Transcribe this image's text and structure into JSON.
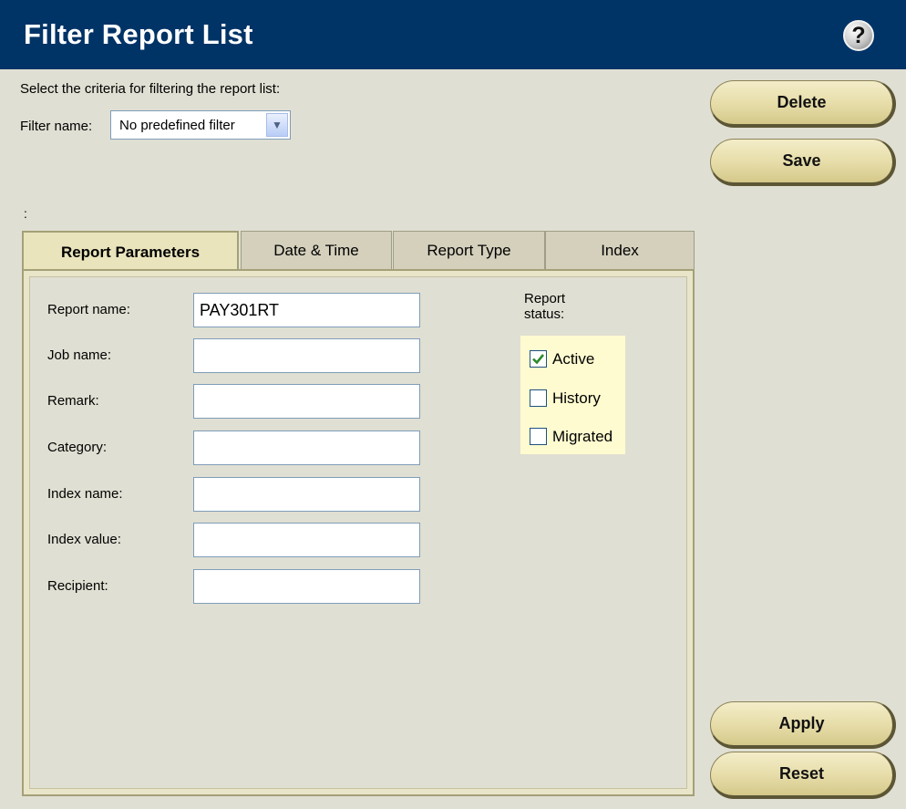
{
  "header": {
    "title": "Filter Report List",
    "help_icon": "help-icon",
    "help_glyph": "?"
  },
  "intro": {
    "criteria_text": "Select the criteria for filtering the report list:",
    "filter_label": "Filter name:",
    "filter_value": "No predefined filter",
    "separator_text": ":"
  },
  "buttons": {
    "delete": "Delete",
    "save": "Save",
    "apply": "Apply",
    "reset": "Reset"
  },
  "tabs": [
    {
      "label": "Report Parameters",
      "active": true
    },
    {
      "label": "Date & Time",
      "active": false
    },
    {
      "label": "Report Type",
      "active": false
    },
    {
      "label": "Index",
      "active": false
    }
  ],
  "fields": [
    {
      "label": "Report name:",
      "value": "PAY301RT"
    },
    {
      "label": "Job name:",
      "value": ""
    },
    {
      "label": "Remark:",
      "value": ""
    },
    {
      "label": "Category:",
      "value": ""
    },
    {
      "label": "Index name:",
      "value": ""
    },
    {
      "label": "Index value:",
      "value": ""
    },
    {
      "label": "Recipient:",
      "value": ""
    }
  ],
  "report_status": {
    "title_line1": "Report",
    "title_line2": "status:",
    "options": [
      {
        "label": "Active",
        "checked": true
      },
      {
        "label": "History",
        "checked": false
      },
      {
        "label": "Migrated",
        "checked": false
      }
    ]
  },
  "colors": {
    "header_bg": "#003366",
    "page_bg": "#e0dfd3",
    "button_face": "#e6dca8",
    "status_bg": "#fffbd0",
    "check_color": "#2a8a2a"
  }
}
